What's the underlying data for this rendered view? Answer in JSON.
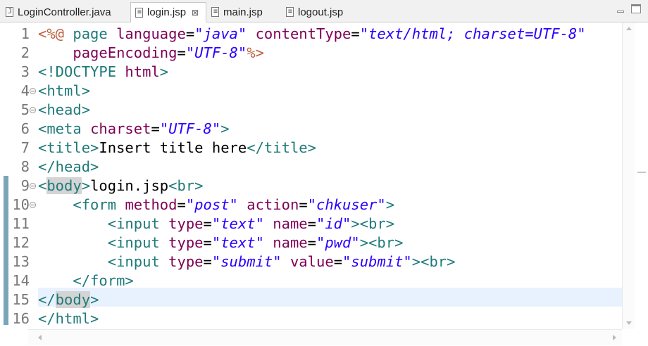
{
  "tabs": [
    {
      "label": "LoginController.java",
      "icon": "java-file-icon",
      "icon_glyph": "J",
      "active": false
    },
    {
      "label": "login.jsp",
      "icon": "jsp-file-icon",
      "icon_glyph": "≡",
      "active": true,
      "close": "⊠"
    },
    {
      "label": "main.jsp",
      "icon": "jsp-file-icon",
      "icon_glyph": "≡",
      "active": false
    },
    {
      "label": "logout.jsp",
      "icon": "jsp-file-icon",
      "icon_glyph": "≡",
      "active": false
    }
  ],
  "window_controls": {
    "minimize": "minimize-icon",
    "maximize": "maximize-icon"
  },
  "editor": {
    "current_line": 15,
    "colors": {
      "tag": "#1f7a7a",
      "attribute": "#7f0055",
      "value": "#2a00ff",
      "directive": "#bf5f3f",
      "text": "#000000",
      "current_line_bg": "#e8f2fe",
      "change_bar": "#7aa5b8"
    },
    "lines": [
      {
        "n": "1",
        "fold": false,
        "tokens": [
          [
            "dl",
            "<%@ "
          ],
          [
            "t",
            "page "
          ],
          [
            "a",
            "language"
          ],
          [
            "x",
            "="
          ],
          [
            "v",
            "\"java\""
          ],
          [
            "x",
            " "
          ],
          [
            "a",
            "contentType"
          ],
          [
            "x",
            "="
          ],
          [
            "v",
            "\"text/html; charset=UTF-8\""
          ]
        ]
      },
      {
        "n": "2",
        "fold": false,
        "tokens": [
          [
            "x",
            "    "
          ],
          [
            "a",
            "pageEncoding"
          ],
          [
            "x",
            "="
          ],
          [
            "v",
            "\"UTF-8\""
          ],
          [
            "dl",
            "%>"
          ]
        ]
      },
      {
        "n": "3",
        "fold": false,
        "tokens": [
          [
            "t",
            "<!DOCTYPE "
          ],
          [
            "a",
            "html"
          ],
          [
            "t",
            ">"
          ]
        ]
      },
      {
        "n": "4",
        "fold": true,
        "tokens": [
          [
            "t",
            "<html>"
          ]
        ]
      },
      {
        "n": "5",
        "fold": true,
        "tokens": [
          [
            "t",
            "<head>"
          ]
        ]
      },
      {
        "n": "6",
        "fold": false,
        "tokens": [
          [
            "t",
            "<meta "
          ],
          [
            "a",
            "charset"
          ],
          [
            "x",
            "="
          ],
          [
            "v",
            "\"UTF-8\""
          ],
          [
            "t",
            ">"
          ]
        ]
      },
      {
        "n": "7",
        "fold": false,
        "tokens": [
          [
            "t",
            "<title>"
          ],
          [
            "x",
            "Insert title here"
          ],
          [
            "t",
            "</title>"
          ]
        ]
      },
      {
        "n": "8",
        "fold": false,
        "tokens": [
          [
            "t",
            "</head>"
          ]
        ]
      },
      {
        "n": "9",
        "fold": true,
        "tokens": [
          [
            "t",
            "<"
          ],
          [
            "th",
            "body"
          ],
          [
            "t",
            ">"
          ],
          [
            "x",
            "login.jsp"
          ],
          [
            "t",
            "<br>"
          ]
        ]
      },
      {
        "n": "10",
        "fold": true,
        "tokens": [
          [
            "x",
            "    "
          ],
          [
            "t",
            "<form "
          ],
          [
            "a",
            "method"
          ],
          [
            "x",
            "="
          ],
          [
            "v",
            "\"post\""
          ],
          [
            "x",
            " "
          ],
          [
            "a",
            "action"
          ],
          [
            "x",
            "="
          ],
          [
            "v",
            "\"chkuser\""
          ],
          [
            "t",
            ">"
          ]
        ]
      },
      {
        "n": "11",
        "fold": false,
        "tokens": [
          [
            "x",
            "        "
          ],
          [
            "t",
            "<input "
          ],
          [
            "a",
            "type"
          ],
          [
            "x",
            "="
          ],
          [
            "v",
            "\"text\""
          ],
          [
            "x",
            " "
          ],
          [
            "a",
            "name"
          ],
          [
            "x",
            "="
          ],
          [
            "v",
            "\"id\""
          ],
          [
            "t",
            "><br>"
          ]
        ]
      },
      {
        "n": "12",
        "fold": false,
        "tokens": [
          [
            "x",
            "        "
          ],
          [
            "t",
            "<input "
          ],
          [
            "a",
            "type"
          ],
          [
            "x",
            "="
          ],
          [
            "v",
            "\"text\""
          ],
          [
            "x",
            " "
          ],
          [
            "a",
            "name"
          ],
          [
            "x",
            "="
          ],
          [
            "v",
            "\"pwd\""
          ],
          [
            "t",
            "><br>"
          ]
        ]
      },
      {
        "n": "13",
        "fold": false,
        "tokens": [
          [
            "x",
            "        "
          ],
          [
            "t",
            "<input "
          ],
          [
            "a",
            "type"
          ],
          [
            "x",
            "="
          ],
          [
            "v",
            "\"submit\""
          ],
          [
            "x",
            " "
          ],
          [
            "a",
            "value"
          ],
          [
            "x",
            "="
          ],
          [
            "v",
            "\"submit\""
          ],
          [
            "t",
            "><br>"
          ]
        ]
      },
      {
        "n": "14",
        "fold": false,
        "tokens": [
          [
            "x",
            "    "
          ],
          [
            "t",
            "</form>"
          ]
        ]
      },
      {
        "n": "15",
        "fold": false,
        "tokens": [
          [
            "t",
            "</"
          ],
          [
            "th",
            "body"
          ],
          [
            "t",
            ">"
          ]
        ]
      },
      {
        "n": "16",
        "fold": false,
        "tokens": [
          [
            "t",
            "</html>"
          ]
        ]
      }
    ]
  }
}
